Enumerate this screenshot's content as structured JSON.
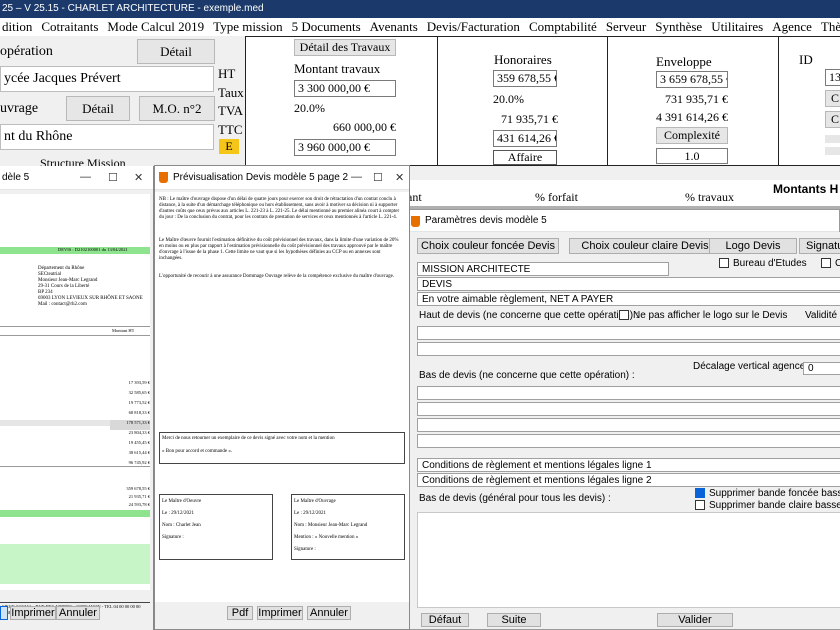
{
  "titlebar": {
    "text": "25  –  V 25.15 - CHARLET ARCHITECTURE - exemple.med"
  },
  "menu": [
    "dition",
    "Cotraitants",
    "Mode Calcul 2019",
    "Type mission",
    "5 Documents",
    "Avenants",
    "Devis/Facturation",
    "Comptabilité",
    "Serveur",
    "Synthèse",
    "Utilitaires",
    "Agence",
    "Thème",
    "?"
  ],
  "left": {
    "operation_label": "opération",
    "detail": "Détail",
    "lycee": "ycée Jacques Prévert",
    "ouvrage_label": "uvrage",
    "detail2": "Détail",
    "mo": "M.O. n°2",
    "rhone": "nt du Rhône",
    "partial": "Structure Mission"
  },
  "amounts": {
    "ht": "HT",
    "taux": "Taux",
    "tva": "TVA",
    "ttc": "TTC",
    "e": "E",
    "detail_travaux": "Détail des Travaux",
    "montant_label": "Montant travaux",
    "montant": "3 300 000,00 €",
    "taux_val": "20.0%",
    "tva_val": "660 000,00 €",
    "ttc_val": "3 960 000,00 €"
  },
  "honoraires": {
    "title": "Honoraires",
    "ht": "359 678,55 €",
    "taux": "20.0%",
    "tva": "71 935,71 €",
    "ttc": "431 614,26 €",
    "affaire": "Affaire"
  },
  "enveloppe": {
    "title": "Enveloppe",
    "ht": "3 659 678,55 €",
    "tva": "731 935,71 €",
    "ttc": "4 391 614,26 €",
    "complexite": "Complexité",
    "coef": "1.0"
  },
  "ident": {
    "title": "ID",
    "val": "13",
    "b1": "C",
    "b2": "C"
  },
  "montants": {
    "title": "Montants H",
    "col1": "ant",
    "col2": "% forfait",
    "col3": "% travaux"
  },
  "preview1": {
    "title": "dèle 5",
    "devis_line": "DEVIS : D2102100001 du 13/04/2021",
    "client": [
      "Département du Rhône",
      "SECteatrial",
      "Monsieur Jean-Marc Legrand",
      "29-31 Cours de la Liberté",
      "BP 234",
      "69003 LYON LEVIEUX SUR RHÔNE ET SAONE",
      "Mail : contact@rh2.com"
    ],
    "montant_ht": "Montant HT",
    "values": [
      "17 393,59 €",
      "32 585,65 €",
      "19 773,52 €",
      "68 818,33 €",
      "178 571,33 €",
      "23 804,33 €",
      "19 455,45 €",
      "38 615,44 €",
      "96 745,92 €"
    ],
    "totals": [
      "359 678,55 €",
      "21 935,71 €",
      "24 593,78 €",
      "405 364,48 €"
    ],
    "footer": "SIEGE SOCIAL : RUE DES ARBRES - 69000 LYON - TEL 04 00 00 00 00",
    "footer2": "SIRET 000 000 000 00000 - APE 7111Z",
    "buttons": {
      "print": "Imprimer",
      "cancel": "Annuler"
    }
  },
  "preview2": {
    "title": "Prévisualisation Devis modèle 5 page 2",
    "para1": "NB : Le maître d'ouvrage dispose d'un délai de quatre jours pour exercer son droit de rétractation d'un contrat conclu à distance, à la suite d'un démarchage téléphonique ou hors établissement, sans avoir à motiver sa décision ni à supporter d'autres coûts que ceux prévus aux articles L. 221-23 à L. 221-25. Le délai mentionné au premier alinéa court à compter du jour : De la conclusion du contrat, pour les contrats de prestation de services et ceux mentionnés à l'article L. 221-4.",
    "para2": "Le Maître d'œuvre fournit l'estimation définitive du coût prévisionnel des travaux, dans la limite d'une variation de 20% en moins ou en plus par rapport à l'estimation prévisionnelle du coût prévisionnel des travaux approuvé par le maître d'ouvrage à l'issue de la phase 1. Cette limite ne vaut que si les hypothèses définies au CCP ou en annexes sont inchangées.",
    "para3": "L'opportunité de recourir à une assurance Dommage Ouvrage relève de la compétence exclusive du maître d'ouvrage.",
    "box1": "Merci de nous retourner un exemplaire de ce devis signé avec votre nom et la mention",
    "box1b": "« Bon pour accord et commande ».",
    "moe": {
      "title": "Le Maître d'Oeuvre",
      "date": "Le : 29/12/2021",
      "nom": "Nom : Charlet Jean",
      "sig": "Signature :"
    },
    "moa": {
      "title": "Le Maître d'Ouvrage",
      "date": "Le : 29/12/2021",
      "nom": "Nom : Monsieur Jean-Marc Legrand",
      "mention": "Mention : « Nouvelle mention »",
      "sig": "Signature :"
    },
    "buttons": {
      "pdf": "Pdf",
      "print": "Imprimer",
      "cancel": "Annuler"
    }
  },
  "params": {
    "title": "Paramètres devis modèle 5",
    "btn_fonce": "Choix couleur foncée Devis",
    "btn_clair": "Choix couleur claire Devis",
    "btn_logo": "Logo Devis",
    "btn_sig": "Signatu",
    "bureau": "Bureau d'Etudes",
    "c_partial": "C",
    "mission": "MISSION ARCHITECTE",
    "devis": "DEVIS",
    "reglement": "En votre aimable règlement, NET A PAYER",
    "haut": "Haut de devis  (ne concerne que cette opération) :",
    "no_logo": "Ne pas afficher le logo sur le Devis",
    "validite": "Validité D",
    "decalage": "Décalage vertical agence :",
    "decalage_val": "0",
    "bas": "Bas de devis  (ne concerne que cette opération) :",
    "cond1": "Conditions de règlement et mentions légales ligne 1",
    "cond2": "Conditions de règlement et mentions légales ligne 2",
    "bas_general": "Bas de devis  (général pour tous les devis) :",
    "suppr_fonce": "Supprimer bande foncée basse",
    "suppr_clair": "Supprimer bande claire basse",
    "defaut": "Défaut",
    "suite": "Suite",
    "valider": "Valider"
  }
}
